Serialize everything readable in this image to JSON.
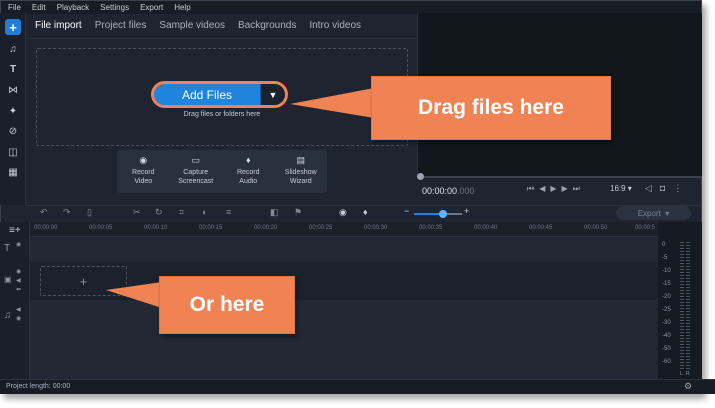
{
  "menu": [
    "File",
    "Edit",
    "Playback",
    "Settings",
    "Export",
    "Help"
  ],
  "import_tabs": [
    "File import",
    "Project files",
    "Sample videos",
    "Backgrounds",
    "Intro videos"
  ],
  "add_files": {
    "label": "Add Files",
    "hint": "Drag files or folders here"
  },
  "record_items": [
    {
      "label": "Record\nVideo",
      "icon": "webcam-icon"
    },
    {
      "label": "Capture\nScreencast",
      "icon": "monitor-icon"
    },
    {
      "label": "Record\nAudio",
      "icon": "microphone-icon"
    },
    {
      "label": "Slideshow\nWizard",
      "icon": "slideshow-icon"
    }
  ],
  "preview": {
    "time_main": "00:00:00",
    "time_ms": ".000",
    "aspect": "16:9"
  },
  "timeline": {
    "ticks": [
      "00:00:00",
      "00:00:05",
      "00:00:10",
      "00:00:15",
      "00:00:20",
      "00:00:25",
      "00:00:30",
      "00:00:35",
      "00:00:40",
      "00:00:45",
      "00:00:50",
      "00:00:5"
    ],
    "export_label": "Export",
    "clip_placeholder": "+"
  },
  "meter_labels": [
    "0",
    "-5",
    "-10",
    "-15",
    "-20",
    "-25",
    "-30",
    "-40",
    "-50",
    "-60"
  ],
  "meter_channels": [
    "L",
    "R"
  ],
  "status": {
    "project_length": "Project length: 00:00"
  },
  "callouts": {
    "top": "Drag files here",
    "bottom": "Or here"
  },
  "colors": {
    "accent": "#1e84dd",
    "callout": "#f08253",
    "background": "#1e2430"
  }
}
